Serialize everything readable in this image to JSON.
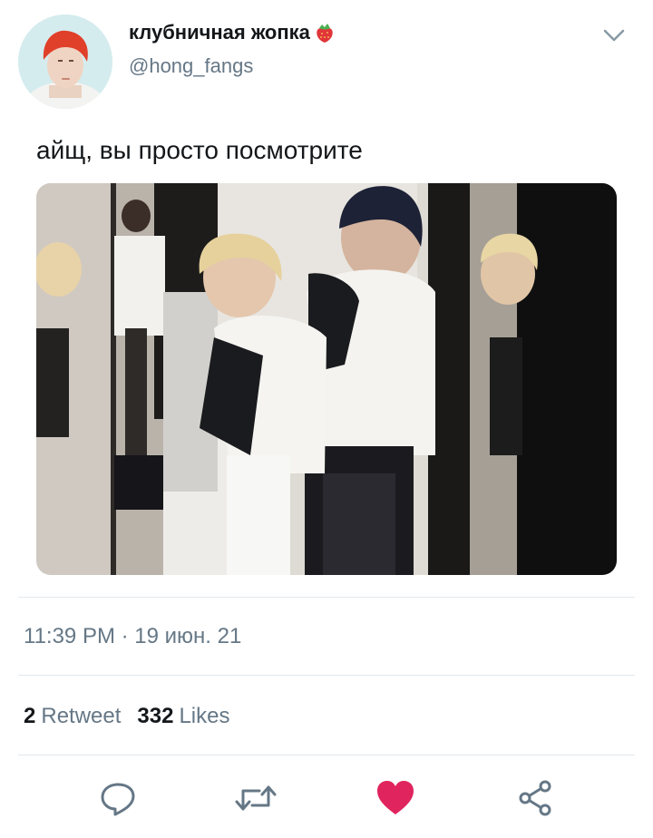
{
  "tweet": {
    "author": {
      "display_name": "клубничная жопка",
      "name_emoji": "strawberry-icon",
      "handle": "@hong_fangs"
    },
    "text": "айщ, вы просто посмотрите",
    "timestamp": "11:39 PM · 19 июн. 21",
    "stats": {
      "retweets_count": "2",
      "retweets_label": "Retweet",
      "likes_count": "332",
      "likes_label": "Likes"
    }
  },
  "actions": [
    {
      "icon": "reply-icon"
    },
    {
      "icon": "retweet-icon"
    },
    {
      "icon": "heart-icon",
      "active": true
    },
    {
      "icon": "share-icon"
    }
  ],
  "colors": {
    "text_primary": "#14171a",
    "text_secondary": "#657786",
    "icon": "#657786",
    "like_active": "#e0245e",
    "divider": "#e1e8ed"
  }
}
